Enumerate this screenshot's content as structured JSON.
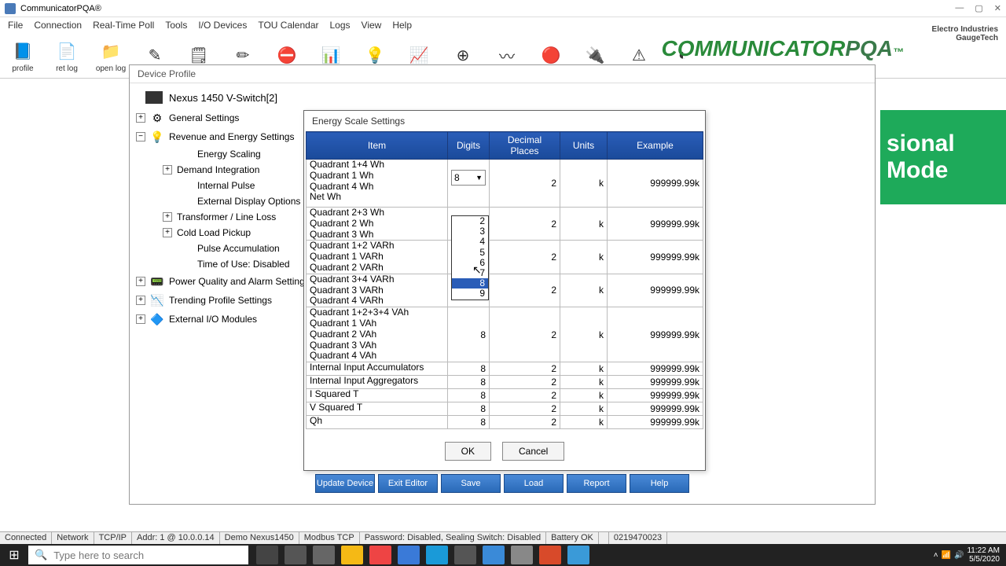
{
  "app_title": "CommunicatorPQA®",
  "menu": [
    "File",
    "Connection",
    "Real-Time Poll",
    "Tools",
    "I/O Devices",
    "TOU Calendar",
    "Logs",
    "View",
    "Help"
  ],
  "toolbar": [
    {
      "label": "profile",
      "icon": "📘"
    },
    {
      "label": "ret log",
      "icon": "📄"
    },
    {
      "label": "open log",
      "icon": "📁"
    },
    {
      "label": "",
      "icon": "✎"
    },
    {
      "label": "",
      "icon": "🗒"
    },
    {
      "label": "",
      "icon": "✏"
    },
    {
      "label": "",
      "icon": "⛔"
    },
    {
      "label": "",
      "icon": "📊"
    },
    {
      "label": "",
      "icon": "💡"
    },
    {
      "label": "",
      "icon": "📈"
    },
    {
      "label": "",
      "icon": "⊕"
    },
    {
      "label": "",
      "icon": "〰"
    },
    {
      "label": "",
      "icon": "🔴"
    },
    {
      "label": "",
      "icon": "🔌"
    },
    {
      "label": "",
      "icon": "⚠"
    },
    {
      "label": "",
      "icon": "◐"
    }
  ],
  "brand": {
    "eig1": "Electro Industries",
    "eig2": "GaugeTech",
    "name": "COMMUNICATOR",
    "suffix": "PQA",
    "tm": "™"
  },
  "side_mode": "sional Mode",
  "device_profile_tab": "Device Profile",
  "nexus": "Nexus 1450 V-Switch[2]",
  "tree": {
    "general": "General Settings",
    "revenue": "Revenue and Energy Settings",
    "energy_scaling": "Energy Scaling",
    "demand": "Demand Integration",
    "internal_pulse": "Internal Pulse",
    "ext_display": "External Display Options",
    "transformer": "Transformer / Line Loss",
    "cold_load": "Cold Load Pickup",
    "pulse_acc": "Pulse Accumulation",
    "tou": "Time of Use: Disabled",
    "power_quality": "Power Quality and Alarm Settings",
    "trending": "Trending Profile Settings",
    "external_io": "External I/O Modules"
  },
  "dialog": {
    "title": "Energy Scale Settings",
    "headers": {
      "item": "Item",
      "digits": "Digits",
      "decimal": "Decimal Places",
      "units": "Units",
      "example": "Example"
    },
    "groups": [
      {
        "items": [
          "Quadrant 1+4 Wh",
          "Quadrant 1 Wh",
          "Quadrant 4 Wh",
          "Net Wh"
        ],
        "digits": "8",
        "dec": "2",
        "units": "k",
        "example": "999999.99k",
        "editor": true
      },
      {
        "items": [
          "Quadrant 2+3 Wh",
          "Quadrant 2 Wh",
          "Quadrant 3 Wh"
        ],
        "digits": "",
        "dec": "2",
        "units": "k",
        "example": "999999.99k"
      },
      {
        "items": [
          "Quadrant 1+2 VARh",
          "Quadrant 1 VARh",
          "Quadrant 2 VARh"
        ],
        "digits": "",
        "dec": "2",
        "units": "k",
        "example": "999999.99k"
      },
      {
        "items": [
          "Quadrant 3+4 VARh",
          "Quadrant 3 VARh",
          "Quadrant 4 VARh"
        ],
        "digits": "",
        "dec": "2",
        "units": "k",
        "example": "999999.99k"
      },
      {
        "items": [
          "Quadrant 1+2+3+4 VAh",
          "Quadrant 1 VAh",
          "Quadrant 2 VAh",
          "Quadrant 3 VAh",
          "Quadrant 4 VAh"
        ],
        "digits": "8",
        "dec": "2",
        "units": "k",
        "example": "999999.99k"
      },
      {
        "items": [
          "Internal Input Accumulators"
        ],
        "digits": "8",
        "dec": "2",
        "units": "k",
        "example": "999999.99k"
      },
      {
        "items": [
          "Internal Input Aggregators"
        ],
        "digits": "8",
        "dec": "2",
        "units": "k",
        "example": "999999.99k"
      },
      {
        "items": [
          "I Squared T"
        ],
        "digits": "8",
        "dec": "2",
        "units": "k",
        "example": "999999.99k"
      },
      {
        "items": [
          "V Squared T"
        ],
        "digits": "8",
        "dec": "2",
        "units": "k",
        "example": "999999.99k"
      },
      {
        "items": [
          "Qh"
        ],
        "digits": "8",
        "dec": "2",
        "units": "k",
        "example": "999999.99k"
      }
    ],
    "dropdown": [
      "2",
      "3",
      "4",
      "5",
      "6",
      "7",
      "8",
      "9"
    ],
    "dropdown_selected": "8",
    "ok": "OK",
    "cancel": "Cancel"
  },
  "bottom_buttons": [
    "Update Device",
    "Exit Editor",
    "Save",
    "Load",
    "Report",
    "Help"
  ],
  "status": [
    "Connected",
    "Network",
    "TCP/IP",
    "Addr: 1 @ 10.0.0.14",
    "Demo Nexus1450",
    "Modbus TCP",
    "Password: Disabled, Sealing Switch: Disabled",
    "Battery OK",
    "",
    "0219470023"
  ],
  "taskbar": {
    "search_placeholder": "Type here to search",
    "time": "11:22 AM",
    "date": "5/5/2020"
  }
}
